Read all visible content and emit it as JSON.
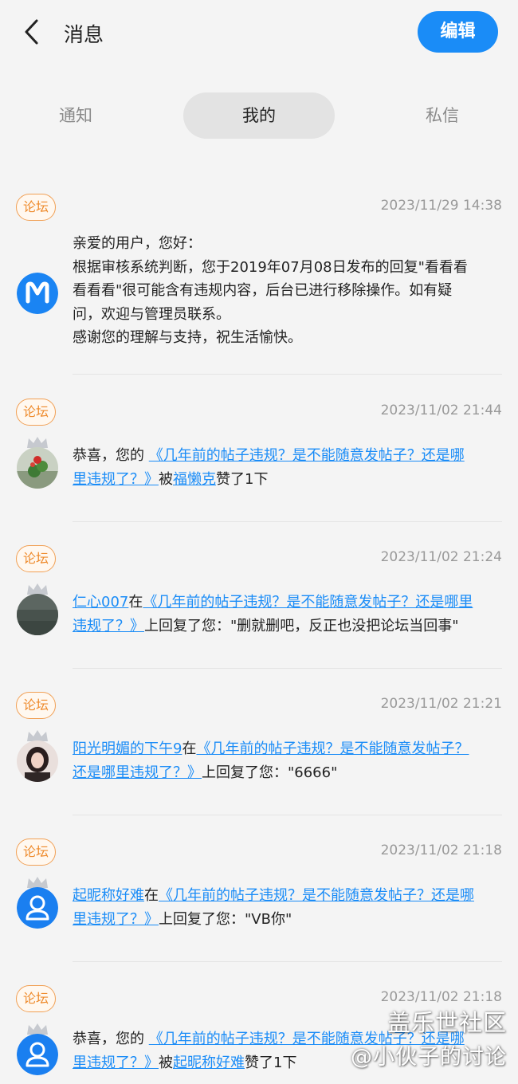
{
  "header": {
    "title": "消息",
    "edit_label": "编辑"
  },
  "tabs": [
    {
      "label": "通知",
      "active": false
    },
    {
      "label": "我的",
      "active": true
    },
    {
      "label": "私信",
      "active": false
    }
  ],
  "messages": [
    {
      "tag": "论坛",
      "time": "2023/11/29 14:38",
      "avatar": "moderator-logo",
      "lines": [
        "亲爱的用户，您好：",
        "根据审核系统判断，您于2019年07月08日发布的回复\"看看看",
        "看看看\"很可能含有违规内容，后台已进行移除操作。如有疑",
        "问，欢迎与管理员联系。",
        "感谢您的理解与支持，祝生活愉快。"
      ]
    },
    {
      "tag": "论坛",
      "time": "2023/11/02 21:44",
      "avatar": "flower-photo",
      "prefix": "恭喜，您的 ",
      "post_a": "《几年前的帖子违规？是不能随意发帖子？还是哪",
      "post_b": "里违规了？》",
      "middle": "被",
      "user": "福懒克",
      "suffix": "赞了1下"
    },
    {
      "tag": "论坛",
      "time": "2023/11/02 21:24",
      "avatar": "water-photo",
      "user": "仁心007",
      "middle": "在",
      "post_a": "《几年前的帖子违规？是不能随意发帖子？还是哪里",
      "post_b": "违规了？》",
      "suffix": "上回复了您：\"删就删吧，反正也没把论坛当回事\""
    },
    {
      "tag": "论坛",
      "time": "2023/11/02 21:21",
      "avatar": "girl-photo",
      "user": "阳光明媚的下午9",
      "middle": "在",
      "post_a": "《几年前的帖子违规？是不能随意发帖子？",
      "post_b": "还是哪里违规了？》",
      "suffix": "上回复了您：\"6666\""
    },
    {
      "tag": "论坛",
      "time": "2023/11/02 21:18",
      "avatar": "default-user",
      "user": "起昵称好难",
      "middle": "在",
      "post_a": "《几年前的帖子违规？是不能随意发帖子？还是哪",
      "post_b": "里违规了？》",
      "suffix": "上回复了您：\"VB你\""
    },
    {
      "tag": "论坛",
      "time": "2023/11/02 21:18",
      "avatar": "default-user",
      "prefix": "恭喜，您的 ",
      "post_a": "《几年前的帖子违规？是不能随意发帖子？还是哪",
      "post_b": "里违规了？》",
      "middle": "被",
      "user": "起昵称好难",
      "suffix": "赞了1下"
    }
  ],
  "watermark": {
    "line1": "盖乐世社区",
    "line2": "@小伙子的讨论"
  },
  "colors": {
    "accent": "#1a8cf7",
    "tag": "#ee8a2b",
    "background": "#f4f4f4"
  }
}
